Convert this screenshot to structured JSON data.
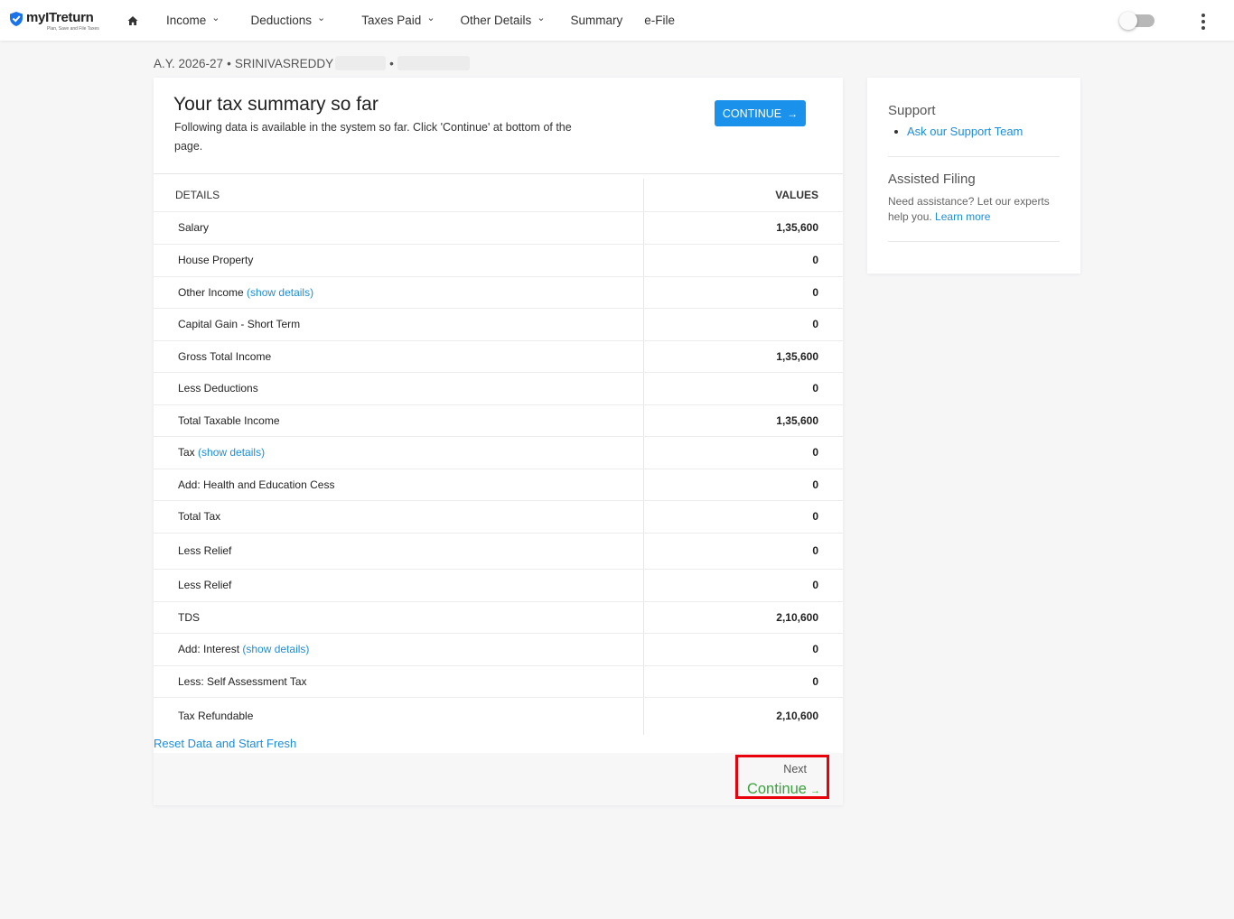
{
  "brand": {
    "name": "myITreturn",
    "tagline": "Plan, Save and File Taxes",
    "color": "#1a73e8"
  },
  "nav": {
    "items": [
      {
        "label": "Income",
        "dropdown": true
      },
      {
        "label": "Deductions",
        "dropdown": true
      },
      {
        "label": "Taxes Paid",
        "dropdown": true
      },
      {
        "label": "Other Details",
        "dropdown": true
      },
      {
        "label": "Summary",
        "dropdown": false
      },
      {
        "label": "e-File",
        "dropdown": false
      }
    ]
  },
  "breadcrumb": {
    "year": "A.Y. 2026-27",
    "separator": "•",
    "name": "SRINIVASREDDY"
  },
  "summary": {
    "title": "Your tax summary so far",
    "subtitle": "Following data is available in the system so far. Click 'Continue' at bottom of the page.",
    "continue_label": "CONTINUE",
    "col_details": "DETAILS",
    "col_values": "VALUES",
    "rows": [
      {
        "label": "Salary",
        "link": "",
        "value": "1,35,600",
        "height": 36
      },
      {
        "label": "House Property",
        "link": "",
        "value": "0",
        "height": 36
      },
      {
        "label": "Other Income",
        "link": "(show details)",
        "value": "0",
        "height": 35
      },
      {
        "label": "Capital Gain - Short Term",
        "link": "",
        "value": "0",
        "height": 36
      },
      {
        "label": "Gross Total Income",
        "link": "",
        "value": "1,35,600",
        "height": 35
      },
      {
        "label": "Less Deductions",
        "link": "",
        "value": "0",
        "height": 36
      },
      {
        "label": "Total Taxable Income",
        "link": "",
        "value": "1,35,600",
        "height": 35
      },
      {
        "label": "Tax",
        "link": "(show details)",
        "value": "0",
        "height": 36
      },
      {
        "label": "Add: Health and Education Cess",
        "link": "",
        "value": "0",
        "height": 35
      },
      {
        "label": "Total Tax",
        "link": "",
        "value": "0",
        "height": 36
      },
      {
        "label": "Less Relief",
        "link": "",
        "value": "0",
        "height": 40
      },
      {
        "label": "Less Relief",
        "link": "",
        "value": "0",
        "height": 36
      },
      {
        "label": "TDS",
        "link": "",
        "value": "2,10,600",
        "height": 35
      },
      {
        "label": "Add: Interest",
        "link": "(show details)",
        "value": "0",
        "height": 36
      },
      {
        "label": "Less: Self Assessment Tax",
        "link": "",
        "value": "0",
        "height": 35
      },
      {
        "label": "Tax Refundable",
        "link": "",
        "value": "2,10,600",
        "height": 42
      }
    ],
    "reset_label": "Reset Data and Start Fresh",
    "next_label": "Next",
    "next_continue": "Continue"
  },
  "support": {
    "title": "Support",
    "link": "Ask our Support Team",
    "assisted_title": "Assisted Filing",
    "assisted_text": "Need assistance? Let our experts help you.",
    "learn_more": "Learn more"
  },
  "colors": {
    "accent": "#1a91ea",
    "link": "#1a8de0",
    "continue_green": "#3ba13e",
    "highlight_red": "#e8000b"
  }
}
